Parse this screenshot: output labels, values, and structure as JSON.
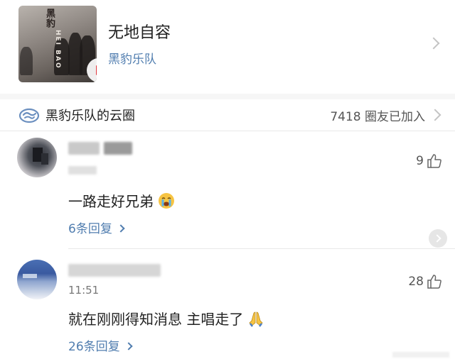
{
  "song": {
    "title": "无地自容",
    "artist": "黑豹乐队",
    "album_text_cn": "黑豹",
    "album_text_en": "HEI BAO"
  },
  "circle": {
    "name": "黑豹乐队的云圈",
    "members": "7418 圈友已加入"
  },
  "comments": [
    {
      "text": "一路走好兄弟",
      "emoji": "crying-face-emoji",
      "likes": "9",
      "replies": "6条回复"
    },
    {
      "time": "11:51",
      "text": "就在刚刚得知消息 主唱走了",
      "emoji": "folded-hands-emoji",
      "likes": "28",
      "replies": "26条回复"
    }
  ],
  "colors": {
    "link": "#507daf",
    "divider": "#e8e8e8",
    "play_accent": "#e0383e"
  }
}
